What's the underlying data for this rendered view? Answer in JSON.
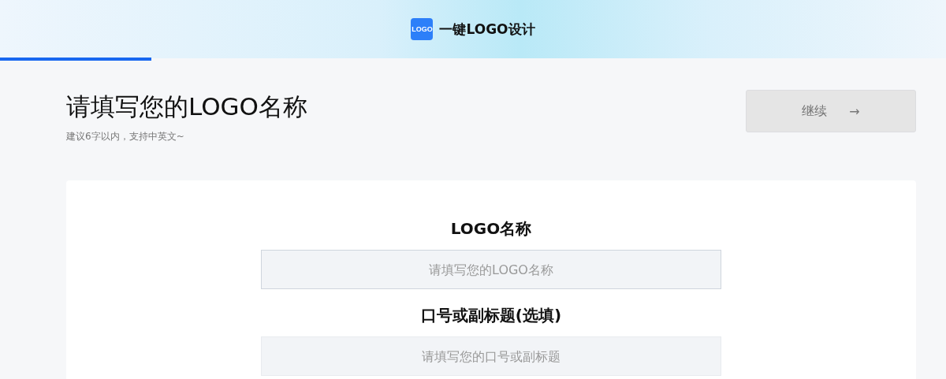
{
  "header": {
    "logo_text": "LOGO",
    "title": "一键LOGO设计"
  },
  "progress": {
    "level": 0.16
  },
  "page": {
    "title": "请填写您的LOGO名称",
    "subtitle": "建议6字以内，支持中英文~"
  },
  "continue_button": {
    "label": "继续",
    "arrow": "→",
    "disabled": true
  },
  "fields": [
    {
      "label": "LOGO名称",
      "placeholder": "请填写您的LOGO名称",
      "focused": true
    },
    {
      "label": "口号或副标题(选填)",
      "placeholder": "请填写您的口号或副标题",
      "focused": false
    }
  ]
}
